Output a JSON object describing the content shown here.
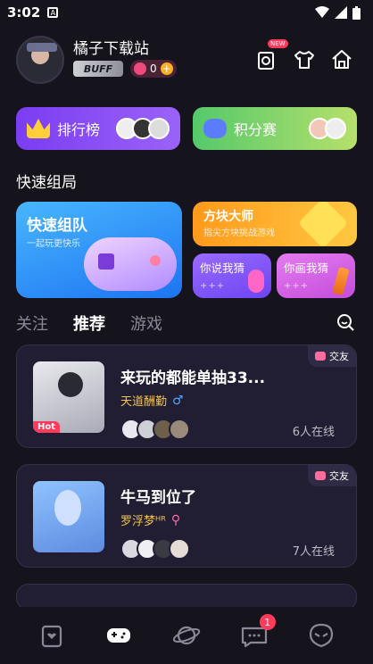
{
  "status": {
    "time": "3:02"
  },
  "profile": {
    "name": "橘子下载站",
    "buff": "BUFF",
    "coins": "0"
  },
  "header_icons": {
    "new_badge": "NEW"
  },
  "banners": {
    "rank": "排行榜",
    "score": "积分赛"
  },
  "quick": {
    "title": "快速组局",
    "big": {
      "title": "快速组队",
      "subtitle": "一起玩更快乐"
    },
    "block": {
      "title": "方块大师",
      "subtitle": "指尖方块挑战游戏"
    },
    "guess": "你说我猜",
    "draw": "你画我猜"
  },
  "tabs": [
    "关注",
    "推荐",
    "游戏"
  ],
  "cards": [
    {
      "title": "来玩的都能单抽33...",
      "host": "天道酬勤",
      "online": "6人在线",
      "tag": "交友",
      "hot": "Hot",
      "gender": "♂"
    },
    {
      "title": "牛马到位了",
      "host": "罗浮梦ᴴᴿ",
      "online": "7人在线",
      "tag": "交友",
      "gender": "⚲"
    }
  ],
  "nav": {
    "message_badge": "1"
  },
  "colors": {
    "background": "#15131c",
    "accent_purple": "#7b3df2",
    "accent_green": "#55c96b",
    "hot_red": "#ff3b5c"
  }
}
